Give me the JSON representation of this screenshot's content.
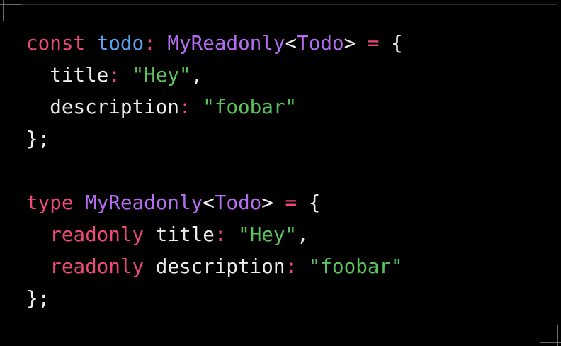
{
  "code_lines": [
    [
      [
        "const",
        "kw"
      ],
      [
        " ",
        "plain"
      ],
      [
        "todo",
        "var"
      ],
      [
        ":",
        "op"
      ],
      [
        " ",
        "plain"
      ],
      [
        "MyReadonly",
        "type"
      ],
      [
        "<",
        "plain"
      ],
      [
        "Todo",
        "type"
      ],
      [
        ">",
        "plain"
      ],
      [
        " ",
        "plain"
      ],
      [
        "=",
        "op"
      ],
      [
        " {",
        "plain"
      ]
    ],
    [
      [
        "  title",
        "plain"
      ],
      [
        ":",
        "op"
      ],
      [
        " ",
        "plain"
      ],
      [
        "\"Hey\"",
        "str"
      ],
      [
        ",",
        "plain"
      ]
    ],
    [
      [
        "  description",
        "plain"
      ],
      [
        ":",
        "op"
      ],
      [
        " ",
        "plain"
      ],
      [
        "\"foobar\"",
        "str"
      ]
    ],
    [
      [
        "};",
        "plain"
      ]
    ],
    [],
    [
      [
        "type",
        "kw"
      ],
      [
        " ",
        "plain"
      ],
      [
        "MyReadonly",
        "type"
      ],
      [
        "<",
        "plain"
      ],
      [
        "Todo",
        "type"
      ],
      [
        ">",
        "plain"
      ],
      [
        " ",
        "plain"
      ],
      [
        "=",
        "op"
      ],
      [
        " {",
        "plain"
      ]
    ],
    [
      [
        "  ",
        "plain"
      ],
      [
        "readonly",
        "kw"
      ],
      [
        " title",
        "plain"
      ],
      [
        ":",
        "op"
      ],
      [
        " ",
        "plain"
      ],
      [
        "\"Hey\"",
        "str"
      ],
      [
        ",",
        "plain"
      ]
    ],
    [
      [
        "  ",
        "plain"
      ],
      [
        "readonly",
        "kw"
      ],
      [
        " description",
        "plain"
      ],
      [
        ":",
        "op"
      ],
      [
        " ",
        "plain"
      ],
      [
        "\"foobar\"",
        "str"
      ]
    ],
    [
      [
        "};",
        "plain"
      ]
    ]
  ]
}
